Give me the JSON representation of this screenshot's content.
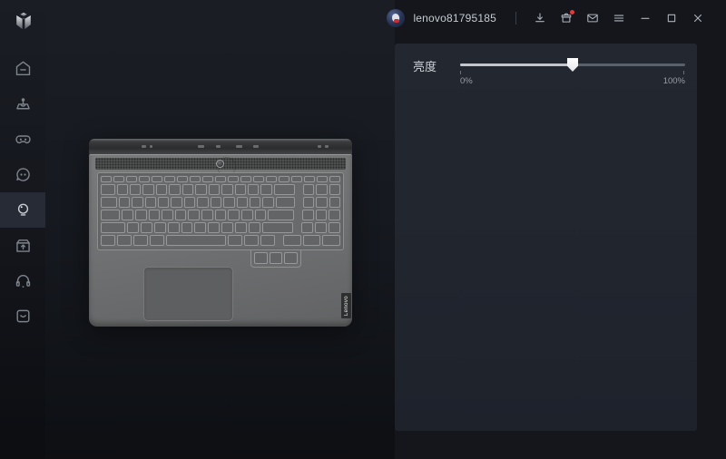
{
  "topbar": {
    "username": "lenovo81795185",
    "icons": [
      {
        "name": "download-icon",
        "badge": false
      },
      {
        "name": "store-icon",
        "badge": true
      },
      {
        "name": "mail-icon",
        "badge": false
      },
      {
        "name": "menu-icon",
        "badge": false
      }
    ],
    "window_controls": [
      {
        "name": "minimize-icon"
      },
      {
        "name": "maximize-icon"
      },
      {
        "name": "close-icon"
      }
    ]
  },
  "sidebar": {
    "logo_icon": "legion-logo",
    "items": [
      {
        "icon": "home-icon",
        "selected": false
      },
      {
        "icon": "joystick-icon",
        "selected": false
      },
      {
        "icon": "gamepad-icon",
        "selected": false
      },
      {
        "icon": "device-face-icon",
        "selected": false
      },
      {
        "icon": "lightbulb-icon",
        "selected": true
      },
      {
        "icon": "update-box-icon",
        "selected": false
      },
      {
        "icon": "headset-icon",
        "selected": false
      },
      {
        "icon": "service-box-icon",
        "selected": false
      }
    ]
  },
  "panel": {
    "brightness_label": "亮度",
    "slider": {
      "value_percent": 50,
      "min_label": "0%",
      "max_label": "100%"
    }
  },
  "laptop": {
    "brand_label": "Lenovo"
  },
  "colors": {
    "accent_fill": "#c3c7cd",
    "track": "#59606a",
    "panel_bg": "#22262f",
    "badge": "#e23b3b",
    "sidebar_selected": "#262b35"
  }
}
